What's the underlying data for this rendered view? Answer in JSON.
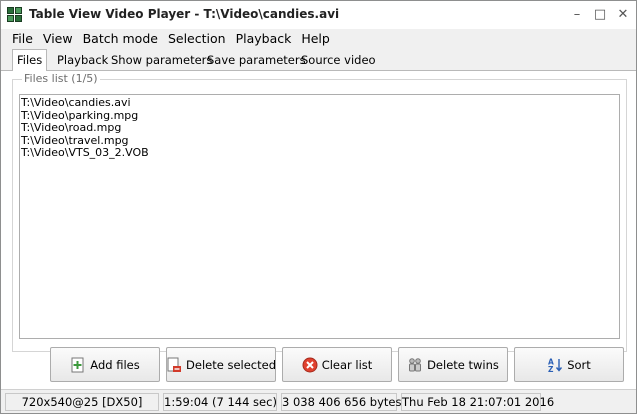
{
  "window": {
    "title": "Table View Video Player - T:\\Video\\candies.avi"
  },
  "menu": [
    "File",
    "View",
    "Batch mode",
    "Selection",
    "Playback",
    "Help"
  ],
  "tabs": [
    "Files",
    "Playback",
    "Show parameters",
    "Save parameters",
    "Source video"
  ],
  "files": {
    "group_label": "Files list (1/5)",
    "items": [
      "T:\\Video\\candies.avi",
      "T:\\Video\\parking.mpg",
      "T:\\Video\\road.mpg",
      "T:\\Video\\travel.mpg",
      "T:\\Video\\VTS_03_2.VOB"
    ]
  },
  "buttons": {
    "add_files": "Add files",
    "delete_selected": "Delete selected",
    "clear_list": "Clear list",
    "delete_twins": "Delete twins",
    "sort": "Sort"
  },
  "status": {
    "format": "720x540@25 [DX50]",
    "duration": "1:59:04 (7 144 sec)",
    "size": "3 038 406 656 bytes",
    "date": "Thu Feb 18 21:07:01 2016"
  },
  "icons": {
    "app": "app-grid-icon",
    "add": "add-file-icon",
    "delete": "delete-file-icon",
    "clear": "clear-icon",
    "twins": "twins-icon",
    "sort": "sort-az-icon"
  },
  "colors": {
    "clear_red": "#e0412f",
    "add_green": "#3c9a3c",
    "sort_blue": "#2a5fb5"
  }
}
